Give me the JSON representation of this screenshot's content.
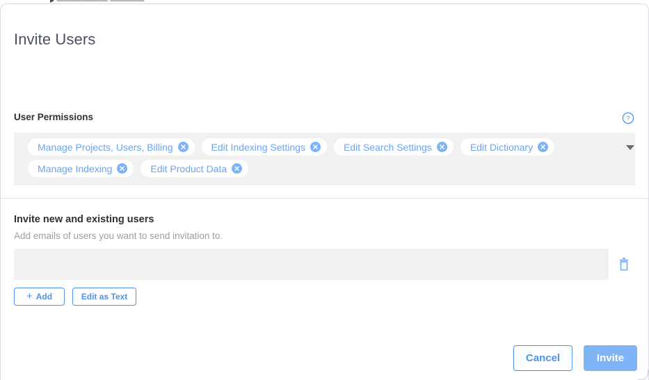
{
  "background": {
    "clipped_text": "▸  ——————  ————"
  },
  "modal": {
    "title": "Invite Users"
  },
  "permissions": {
    "label": "User Permissions",
    "help_icon": "help-circle-icon",
    "dropdown_icon": "chevron-down-icon",
    "remove_icon": "close-circle-icon",
    "chips": [
      {
        "label": "Manage Projects, Users, Billing"
      },
      {
        "label": "Edit Indexing Settings"
      },
      {
        "label": "Edit Search Settings"
      },
      {
        "label": "Edit Dictionary"
      },
      {
        "label": "Manage Indexing"
      },
      {
        "label": "Edit Product Data"
      }
    ]
  },
  "invite": {
    "heading": "Invite new and existing users",
    "subtitle": "Add emails of users you want to send invitation to.",
    "email_value": "",
    "email_placeholder": "",
    "delete_icon": "trash-icon",
    "add_button": {
      "label": "Add",
      "icon": "plus-icon"
    },
    "edit_as_text_button": {
      "label": "Edit as Text"
    }
  },
  "footer": {
    "cancel_label": "Cancel",
    "invite_label": "Invite"
  },
  "colors": {
    "accent_blue": "#4d93f0",
    "chip_blue": "#6aa3f0",
    "invite_fill": "#7eb3f5",
    "field_gray": "#f1f1f1",
    "title_gray": "#4a4f63",
    "muted_gray": "#9a9da4"
  }
}
